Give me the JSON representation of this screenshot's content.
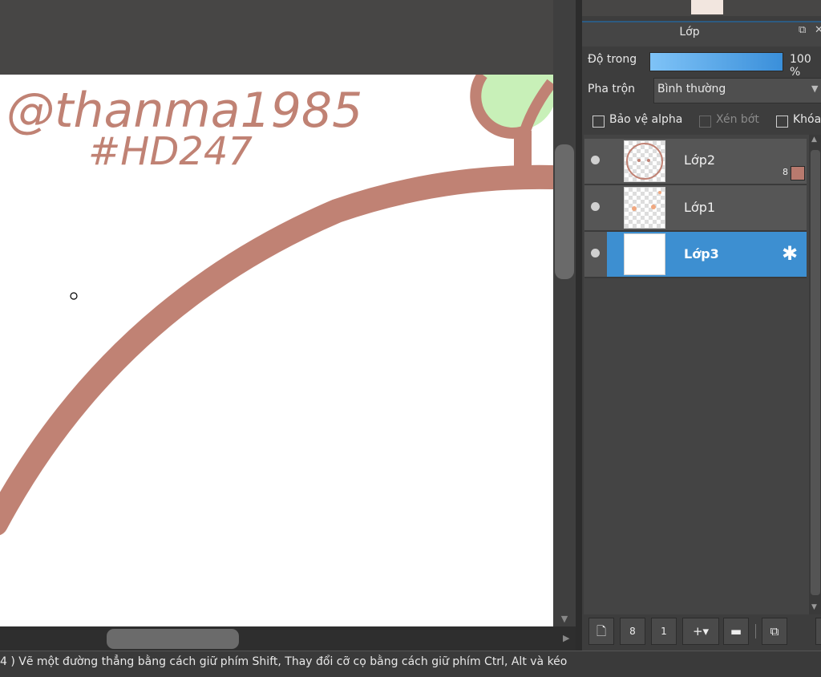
{
  "canvas": {
    "signature_line1": "@thanma1985",
    "signature_line2": "#HD247",
    "stroke_color": "#c08274",
    "accent_green": "#c8f0b8"
  },
  "layer_panel": {
    "title": "Lớp",
    "popout_icon": "popout-icon",
    "opacity_label": "Độ trong",
    "opacity_value": "100 %",
    "opacity_fraction": 1.0,
    "blend_label": "Pha trộn",
    "blend_value": "Bình thường",
    "protect_alpha_label": "Bảo vệ alpha",
    "clipping_label": "Xén bớt",
    "lock_label": "Khóa"
  },
  "layers": [
    {
      "name": "Lớp2",
      "selected": false,
      "badge": "8"
    },
    {
      "name": "Lớp1",
      "selected": false
    },
    {
      "name": "Lớp3",
      "selected": true,
      "settings_icon": "gear-icon"
    }
  ],
  "toolbar": {
    "icons": [
      "new-layer-icon",
      "new-8bit-layer-icon",
      "new-1bit-layer-icon",
      "add-layer-menu-icon",
      "folder-icon",
      "duplicate-icon"
    ]
  },
  "status": {
    "text": "4 )   Vẽ một đường thẳng bằng cách giữ phím Shift, Thay đổi cỡ cọ bằng cách giữ phím Ctrl, Alt và kéo"
  }
}
